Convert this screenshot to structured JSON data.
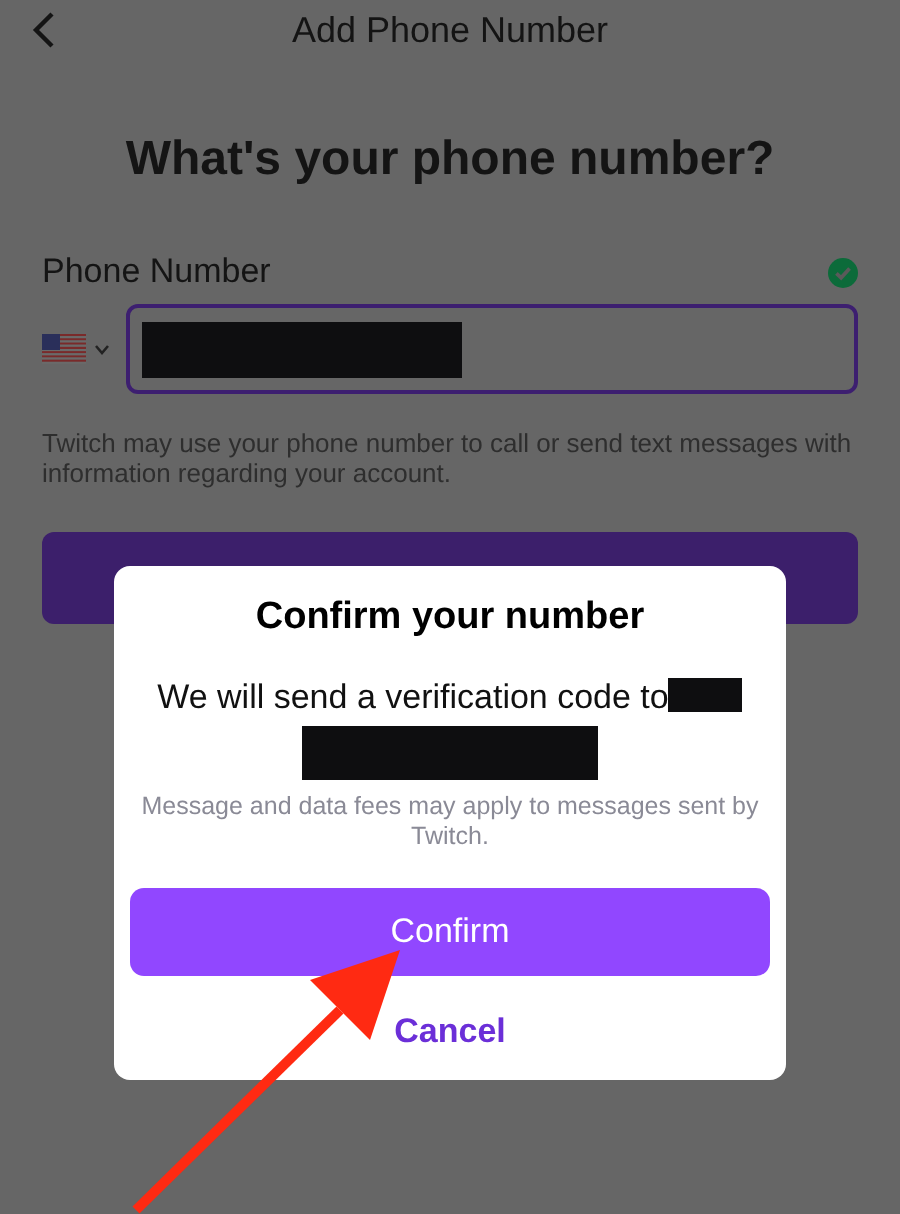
{
  "header": {
    "title": "Add Phone Number"
  },
  "heading": "What's your phone number?",
  "phone": {
    "label": "Phone Number",
    "valid": true
  },
  "helper": "Twitch may use your phone number to call or send text messages with information regarding your account.",
  "dialog": {
    "title": "Confirm your number",
    "message": "We will send a verification code to",
    "note": "Message and data fees may apply to messages sent by Twitch.",
    "buttons": [
      {
        "label": "Confirm",
        "kind": "primary"
      },
      {
        "label": "Cancel",
        "kind": "text"
      }
    ]
  }
}
